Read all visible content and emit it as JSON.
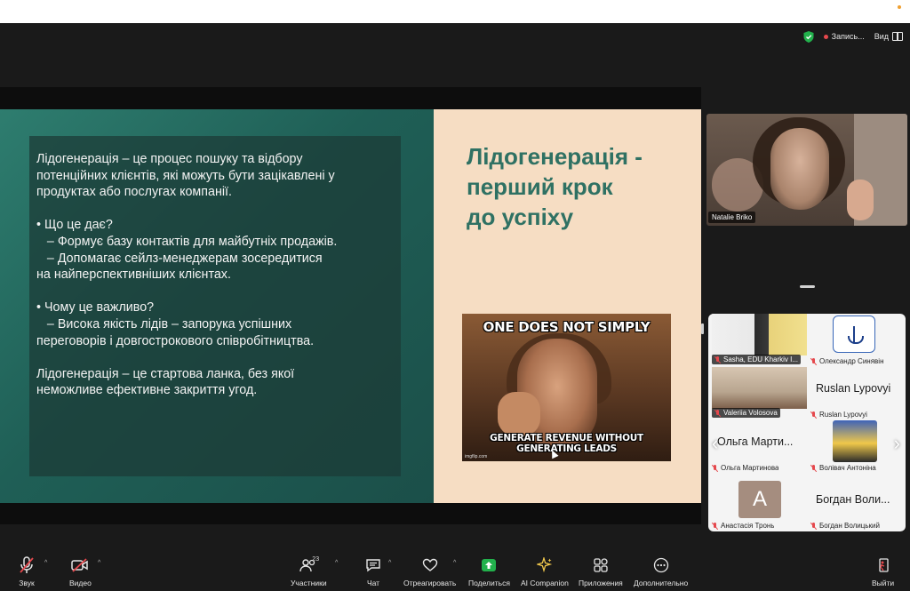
{
  "topbar": {
    "recording_label": "Запись...",
    "view_label": "Вид"
  },
  "slide": {
    "body": {
      "intro": [
        "Лідогенерація – це процес пошуку та відбору",
        "потенційних клієнтів, які можуть бути зацікавлені у",
        "продуктах або послугах компанії."
      ],
      "q1": [
        "• Що це дає?",
        "   – Формує базу контактів для майбутніх продажів.",
        "   – Допомагає сейлз-менеджерам зосередитися",
        "на найперспективніших клієнтах."
      ],
      "q2": [
        "• Чому це важливо?",
        "   – Висока якість лідів – запорука успішних",
        "переговорів і довгострокового співробітництва."
      ],
      "outro": [
        "Лідогенерація – це стартова ланка, без якої",
        "неможливе ефективне закриття угод."
      ]
    },
    "title_lines": [
      "Лідогенерація -",
      "перший крок",
      "до успіху"
    ],
    "meme": {
      "top_caption": "ONE DOES NOT SIMPLY",
      "bottom_caption": "GENERATE REVENUE WITHOUT GENERATING LEADS",
      "watermark": "imgflip.com"
    }
  },
  "speaker": {
    "name": "Natalie Briko"
  },
  "gallery": {
    "tiles": [
      {
        "label": "Sasha, EDU Kharkiv I..."
      },
      {
        "label": "Олександр Синявін"
      },
      {
        "label": "Valeriia Volosova"
      },
      {
        "big": "Ruslan Lypovyi",
        "label": "Ruslan Lypovyi"
      },
      {
        "big": "Ольга Марти...",
        "label": "Ольга Мартинова"
      },
      {
        "label": "Волівач Антоніна"
      },
      {
        "avatar": "A",
        "label": "Анастасія Тронь"
      },
      {
        "big": "Богдан Воли...",
        "label": "Богдан Волицький"
      }
    ],
    "prev": "‹",
    "next": "›"
  },
  "toolbar": {
    "audio": "Звук",
    "video": "Видео",
    "participants": "Участники",
    "participants_count": "23",
    "chat": "Чат",
    "react": "Отреагировать",
    "share": "Поделиться",
    "ai": "AI Companion",
    "apps": "Приложения",
    "more": "Дополнительно",
    "leave": "Выйти"
  },
  "colors": {
    "window_bg": "#1a1a1a",
    "slide_teal": "#2e7d6f",
    "slide_cream": "#f6ddc3",
    "title_green": "#2f7163",
    "share_green": "#22b14c",
    "muted_red": "#e5484d"
  }
}
